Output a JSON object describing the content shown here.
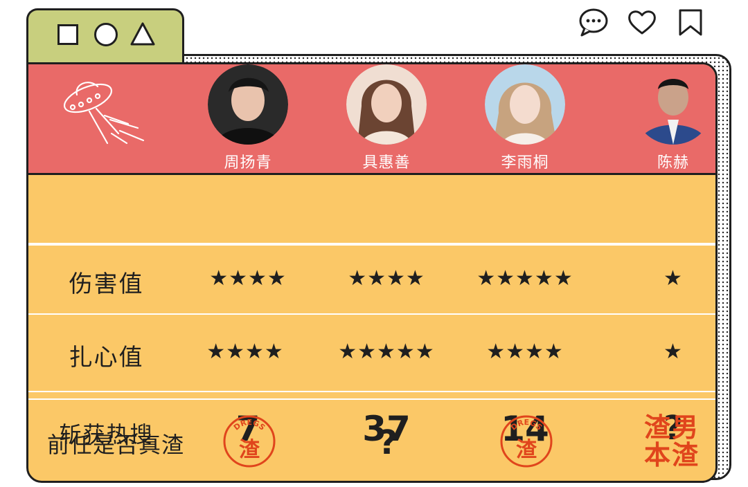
{
  "tab_shapes": [
    "square-icon",
    "circle-icon",
    "triangle-icon"
  ],
  "action_icons": [
    "comment-icon",
    "heart-icon",
    "bookmark-icon"
  ],
  "colors": {
    "header": "#e96a68",
    "body": "#fbc867",
    "tab": "#c8cf7e",
    "accent": "#e0451c"
  },
  "people": [
    {
      "name": "周扬青"
    },
    {
      "name": "具惠善"
    },
    {
      "name": "李雨桐"
    },
    {
      "name": "陈赫"
    }
  ],
  "rows": [
    {
      "label": "伤害值",
      "values": [
        "★★★★",
        "★★★★",
        "★★★★★",
        "★"
      ]
    },
    {
      "label": "扎心值",
      "values": [
        "★★★★",
        "★★★★★",
        "★★★★",
        "★"
      ]
    },
    {
      "label": "斩获热搜",
      "values": [
        "7",
        "37",
        "14",
        "?"
      ]
    },
    {
      "label": "前任是否真渣",
      "stamp": {
        "top_text": "DREGS",
        "char": "渣"
      },
      "question": "?",
      "verdict": [
        "渣男",
        "本渣"
      ]
    }
  ]
}
